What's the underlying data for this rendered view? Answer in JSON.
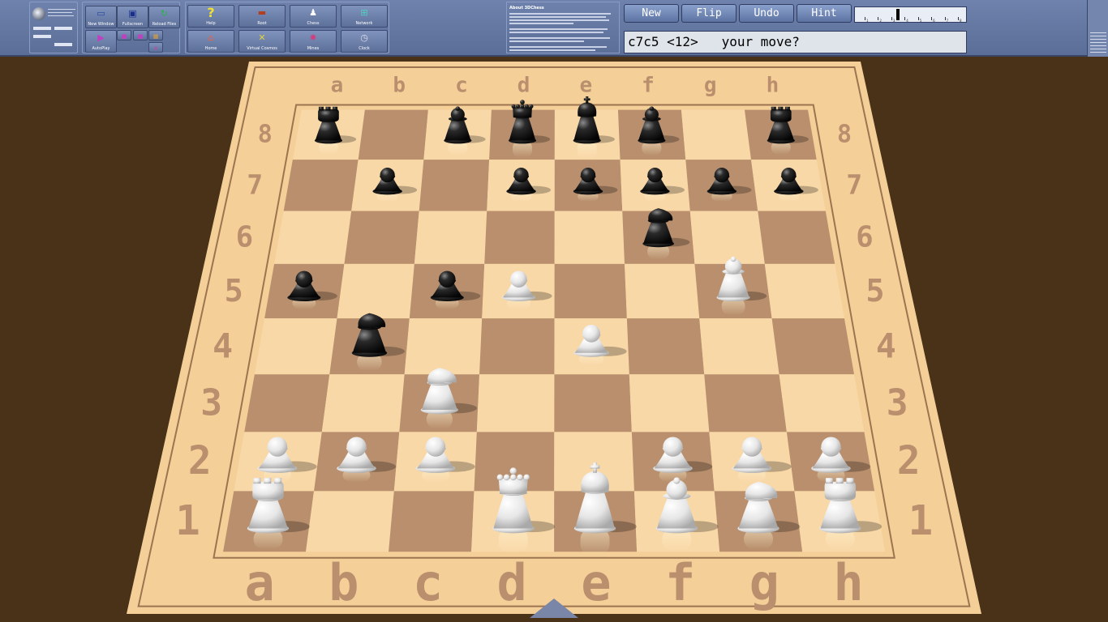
{
  "toolbar": {
    "group1_buttons": [
      {
        "label": "New Window",
        "icon": "window-icon",
        "glyph": "▭"
      },
      {
        "label": "Fullscreen",
        "icon": "fullscreen-icon",
        "glyph": "▣"
      },
      {
        "label": "Reload Files",
        "icon": "reload-icon",
        "glyph": "↻"
      },
      {
        "label": "AutoPlay",
        "icon": "autoplay-icon",
        "glyph": "▶"
      }
    ],
    "group2_buttons": [
      {
        "label": "Help",
        "icon": "help-icon",
        "glyph": "?"
      },
      {
        "label": "Root",
        "icon": "root-icon",
        "glyph": "▬"
      },
      {
        "label": "Chess",
        "icon": "chess-icon",
        "glyph": "♟"
      },
      {
        "label": "Network",
        "icon": "network-icon",
        "glyph": "⊞"
      },
      {
        "label": "Home",
        "icon": "home-icon",
        "glyph": "⌂"
      },
      {
        "label": "Virtual Cosmos",
        "icon": "cosmos-icon",
        "glyph": "✕"
      },
      {
        "label": "Mines",
        "icon": "mines-icon",
        "glyph": "✸"
      },
      {
        "label": "Clock",
        "icon": "clock-icon",
        "glyph": "◷"
      }
    ],
    "about_title": "About 3DChess"
  },
  "controls": {
    "buttons": [
      "New",
      "Flip",
      "Undo",
      "Hint"
    ],
    "slider": {
      "ticks": [
        1,
        2,
        3,
        4,
        5,
        6,
        7,
        8
      ],
      "level": 3
    }
  },
  "status": {
    "text": "c7c5 <12>   your move?"
  },
  "board": {
    "files": [
      "a",
      "b",
      "c",
      "d",
      "e",
      "f",
      "g",
      "h"
    ],
    "ranks": [
      "1",
      "2",
      "3",
      "4",
      "5",
      "6",
      "7",
      "8"
    ],
    "colors": {
      "light": "#f9d8a8",
      "dark": "#b98f6d",
      "frame": "#f4cf98",
      "frame_line": "#9c7550"
    },
    "pieces": [
      {
        "sq": "a8",
        "piece": "rook",
        "color": "black"
      },
      {
        "sq": "c8",
        "piece": "bishop",
        "color": "black"
      },
      {
        "sq": "d8",
        "piece": "queen",
        "color": "black"
      },
      {
        "sq": "e8",
        "piece": "king",
        "color": "black"
      },
      {
        "sq": "f8",
        "piece": "bishop",
        "color": "black"
      },
      {
        "sq": "h8",
        "piece": "rook",
        "color": "black"
      },
      {
        "sq": "b7",
        "piece": "pawn",
        "color": "black"
      },
      {
        "sq": "d7",
        "piece": "pawn",
        "color": "black"
      },
      {
        "sq": "e7",
        "piece": "pawn",
        "color": "black"
      },
      {
        "sq": "f7",
        "piece": "pawn",
        "color": "black"
      },
      {
        "sq": "g7",
        "piece": "pawn",
        "color": "black"
      },
      {
        "sq": "h7",
        "piece": "pawn",
        "color": "black"
      },
      {
        "sq": "f6",
        "piece": "knight",
        "color": "black"
      },
      {
        "sq": "a5",
        "piece": "pawn",
        "color": "black"
      },
      {
        "sq": "c5",
        "piece": "pawn",
        "color": "black"
      },
      {
        "sq": "b4",
        "piece": "knight",
        "color": "black"
      },
      {
        "sq": "d5",
        "piece": "pawn",
        "color": "white"
      },
      {
        "sq": "g5",
        "piece": "bishop",
        "color": "white"
      },
      {
        "sq": "e4",
        "piece": "pawn",
        "color": "white"
      },
      {
        "sq": "c3",
        "piece": "knight",
        "color": "white"
      },
      {
        "sq": "a2",
        "piece": "pawn",
        "color": "white"
      },
      {
        "sq": "b2",
        "piece": "pawn",
        "color": "white"
      },
      {
        "sq": "c2",
        "piece": "pawn",
        "color": "white"
      },
      {
        "sq": "f2",
        "piece": "pawn",
        "color": "white"
      },
      {
        "sq": "g2",
        "piece": "pawn",
        "color": "white"
      },
      {
        "sq": "h2",
        "piece": "pawn",
        "color": "white"
      },
      {
        "sq": "a1",
        "piece": "rook",
        "color": "white"
      },
      {
        "sq": "d1",
        "piece": "queen",
        "color": "white"
      },
      {
        "sq": "e1",
        "piece": "king",
        "color": "white"
      },
      {
        "sq": "f1",
        "piece": "bishop",
        "color": "white"
      },
      {
        "sq": "g1",
        "piece": "knight",
        "color": "white"
      },
      {
        "sq": "h1",
        "piece": "rook",
        "color": "white"
      }
    ]
  }
}
